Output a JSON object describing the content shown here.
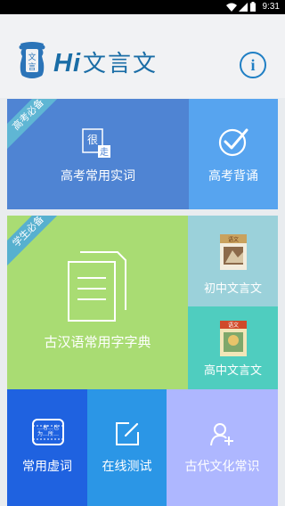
{
  "status_bar": {
    "time": "9:31"
  },
  "header": {
    "app_name_latin": "Hi",
    "app_name_cn": "文言文",
    "info_label": "i"
  },
  "section_gaokao": {
    "badge": "高考必备",
    "tiles": [
      {
        "label": "高考常用实词",
        "icon": "book-card-icon",
        "color": "#4f84d3"
      },
      {
        "label": "高考背诵",
        "icon": "check-circle-icon",
        "color": "#57a4ef"
      }
    ]
  },
  "section_student": {
    "badge": "学生必备",
    "tiles": [
      {
        "label": "古汉语常用字字典",
        "icon": "documents-icon",
        "color": "#a9dc73"
      },
      {
        "label": "初中文言文",
        "icon": "junior-textbook-icon",
        "color": "#9bd1da"
      },
      {
        "label": "高中文言文",
        "icon": "senior-textbook-icon",
        "color": "#4fcdbf"
      }
    ]
  },
  "bottom_tiles": [
    {
      "label": "常用虚词",
      "icon": "scroll-icon",
      "color": "#1f62e0",
      "scroll_lines": [
        "…者…也",
        "为…所…"
      ]
    },
    {
      "label": "在线测试",
      "icon": "edit-icon",
      "color": "#2b96e6"
    },
    {
      "label": "古代文化常识",
      "icon": "add-user-icon",
      "color": "#aeb7ff"
    }
  ]
}
